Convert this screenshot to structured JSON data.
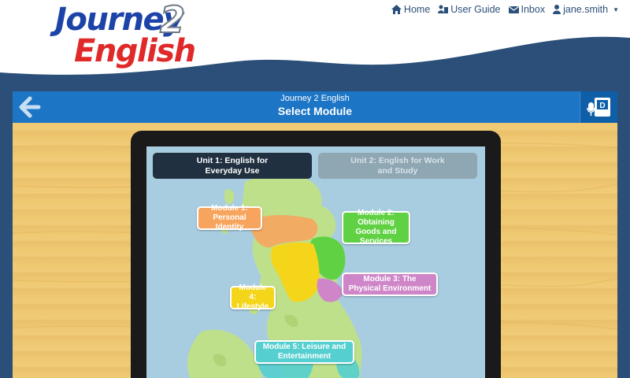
{
  "brand": {
    "line1": "Journey",
    "numeral": "2",
    "line2": "English"
  },
  "topnav": {
    "home": "Home",
    "user_guide": "User Guide",
    "inbox": "Inbox",
    "user": "jane.smith"
  },
  "titlebar": {
    "subtitle": "Journey 2 English",
    "title": "Select Module"
  },
  "units": [
    {
      "label": "Unit 1: English for Everyday Use",
      "state": "selected"
    },
    {
      "label": "Unit 2: English for Work and Study",
      "state": "unselected"
    }
  ],
  "modules": [
    {
      "label": "Module 1: Personal Identity",
      "color": "#f7a55e"
    },
    {
      "label": "Module 2: Obtaining Goods and Services",
      "color": "#5fd142"
    },
    {
      "label": "Module 3: The Physical Environment",
      "color": "#cf86c9"
    },
    {
      "label": "Module 4: Lifestyle",
      "color": "#f5d51a"
    },
    {
      "label": "Module 5: Leisure and Entertainment",
      "color": "#55cfcf"
    }
  ],
  "colors": {
    "header_bg": "#ffffff",
    "page_bg": "#2b4f78",
    "titlebar": "#1d75c5",
    "logo_blue": "#1c43a8",
    "logo_red": "#e02a2a",
    "map_land": "#bfe08a",
    "map_sea": "#a9cde0"
  },
  "icons": [
    "home-icon",
    "user-guide-icon",
    "inbox-icon",
    "user-icon",
    "back-arrow-icon",
    "dictionary-icon"
  ]
}
